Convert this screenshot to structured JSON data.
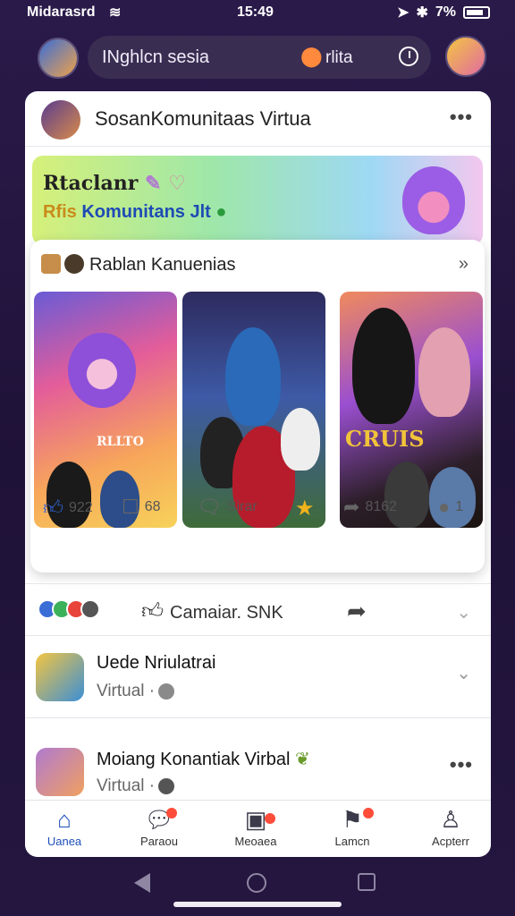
{
  "status": {
    "carrier": "Midarasrd",
    "time": "15:49",
    "battery": "7%"
  },
  "search": {
    "placeholder_text": "INghlcn sesia",
    "location_label": "rlita"
  },
  "post": {
    "title": "SosanKomunitaas Virtua",
    "banner": {
      "line1": "Rtaclanr",
      "line2_prefix": "Rfis",
      "line2_main": "Komunitans Jlt"
    },
    "inner_card": {
      "title": "Rablan Kanuenias",
      "tile3_caption": "CRUIS",
      "tile1_caption": "RLLTO"
    },
    "actions": {
      "likes": "922",
      "comments": "68",
      "share_label": "Sirar",
      "forwards": "8162",
      "replies": "1"
    },
    "reaction_label": "Camaiar. SNK"
  },
  "list": [
    {
      "name": "Uede Nriulatrai",
      "sub": "Virtual ·"
    },
    {
      "name": "Moiang Konantiak Virbal",
      "sub": "Virtual ·"
    }
  ],
  "nav": {
    "items": [
      {
        "label": "Uanea",
        "icon": "home-icon"
      },
      {
        "label": "Paraou",
        "icon": "chat-icon"
      },
      {
        "label": "Meoaea",
        "icon": "media-icon"
      },
      {
        "label": "Lamcn",
        "icon": "launch-icon"
      },
      {
        "label": "Acpterr",
        "icon": "profile-icon"
      }
    ]
  },
  "colors": {
    "accent": "#1d4fb8",
    "background": "#24163f",
    "badge": "#ff4d3a"
  }
}
